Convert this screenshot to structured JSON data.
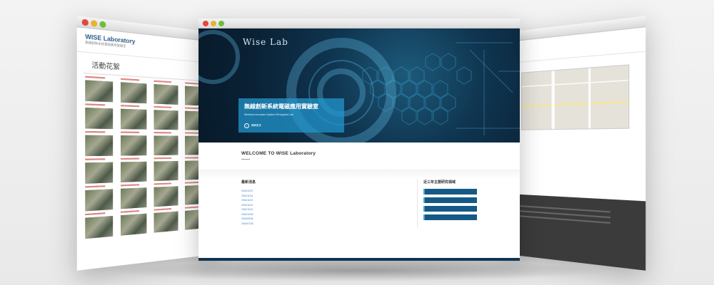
{
  "left_window": {
    "logo": "WISE Laboratory",
    "logo_sub": "無線創新系統電磁應用實驗室",
    "page_title": "活動花絮"
  },
  "right_window": {},
  "center_window": {
    "logo": "Wise Lab",
    "hero": {
      "title": "無線創新系統電磁應用實驗室",
      "subtitle": "Wireless Innovation System EM Applied Lab",
      "more": "瞭解更多"
    },
    "welcome": {
      "heading": "WELCOME TO WISE Laboratory"
    },
    "news": {
      "heading": "最新消息",
      "items": [
        {
          "date": "2016/12/07"
        },
        {
          "date": "2016/11/01"
        },
        {
          "date": "2016/11/01"
        },
        {
          "date": "2016/11/01"
        },
        {
          "date": "2016/11/01"
        },
        {
          "date": "2016/10/03"
        },
        {
          "date": "2016/09/26"
        },
        {
          "date": "2016/07/28"
        }
      ]
    },
    "topics": {
      "heading": "近三年主要研究領域"
    }
  },
  "colors": {
    "hero_dark": "#0a2236",
    "accent_blue": "#2196cd",
    "topic_blue": "#155a86",
    "link_blue": "#3b7fc4"
  }
}
